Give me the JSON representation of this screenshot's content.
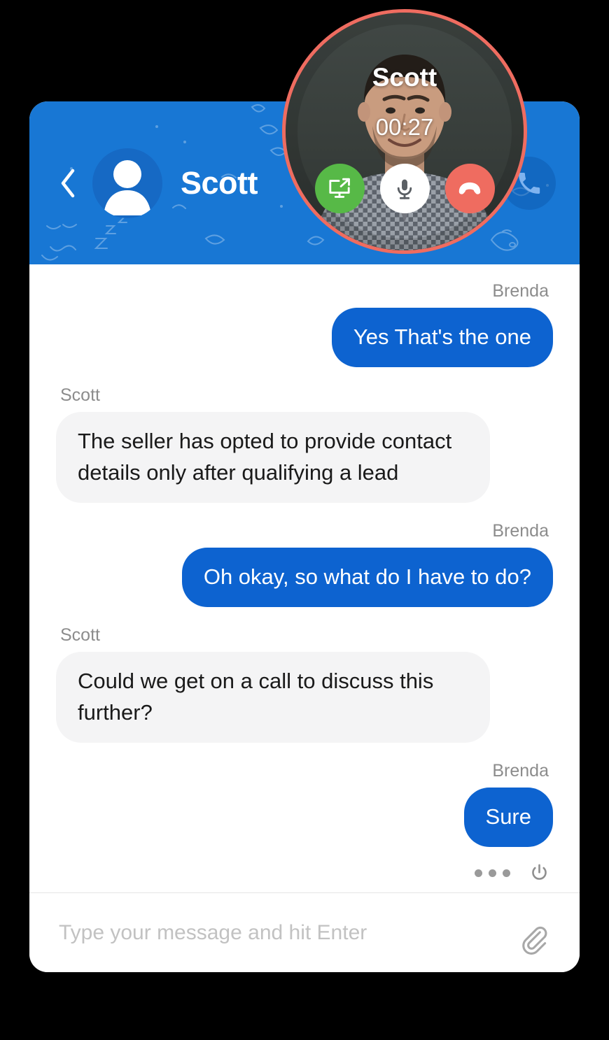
{
  "colors": {
    "header_blue": "#1877d4",
    "bubble_blue": "#0d63d0",
    "bubble_gray": "#f4f4f5",
    "accent_coral": "#ef6c60",
    "share_green": "#57b947",
    "page_background": "#000000",
    "card_background": "#ffffff",
    "sender_label": "#8c8c8c",
    "placeholder": "#c2c2c2"
  },
  "header": {
    "title": "Scott",
    "back_icon": "chevron-left-icon",
    "avatar_icon": "user-avatar-icon",
    "call_icon": "phone-icon"
  },
  "call_overlay": {
    "name": "Scott",
    "timer": "00:27",
    "controls": [
      {
        "id": "screen-share",
        "icon": "screen-share-icon",
        "color": "#57b947"
      },
      {
        "id": "mute",
        "icon": "microphone-icon",
        "color": "#ffffff"
      },
      {
        "id": "hangup",
        "icon": "phone-hangup-icon",
        "color": "#ef6c60"
      }
    ]
  },
  "messages": [
    {
      "sender": "Brenda",
      "side": "right",
      "text": "Yes That's the one"
    },
    {
      "sender": "Scott",
      "side": "left",
      "text": "The seller has opted to provide contact details only after qualifying a lead"
    },
    {
      "sender": "Brenda",
      "side": "right",
      "text": "Oh okay, so what do I have to do?"
    },
    {
      "sender": "Scott",
      "side": "left",
      "text": "Could we get on a call to discuss this further?"
    },
    {
      "sender": "Brenda",
      "side": "right",
      "text": "Sure"
    }
  ],
  "status": {
    "typing_indicator": "three-dots-icon",
    "power_icon": "power-icon"
  },
  "composer": {
    "placeholder": "Type your message and hit Enter",
    "value": "",
    "attach_icon": "paperclip-icon"
  }
}
